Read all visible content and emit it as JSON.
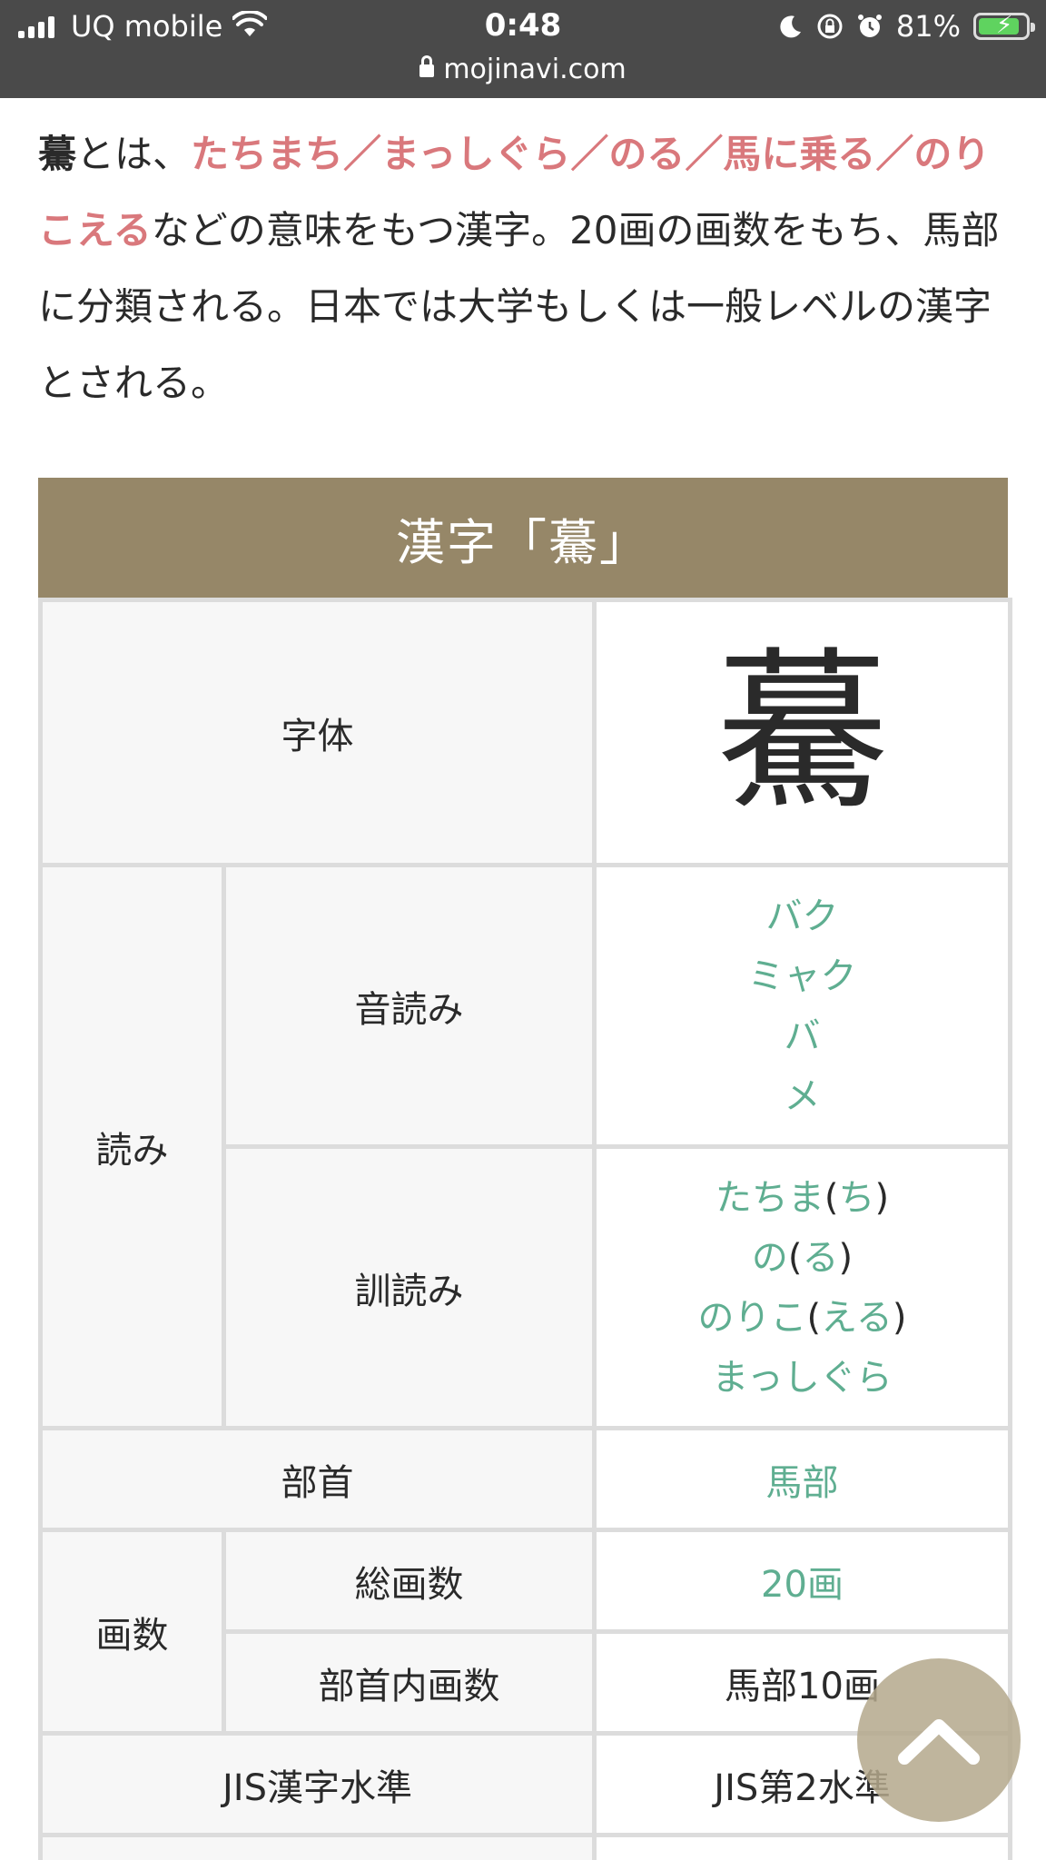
{
  "status_bar": {
    "carrier": "UQ mobile",
    "time": "0:48",
    "battery": "81%",
    "url": "mojinavi.com"
  },
  "intro": {
    "kanji": "驀",
    "after_kanji": "とは、",
    "meanings": "たちまち／まっしぐら／のる／馬に乗る／のりこえる",
    "rest": "などの意味をもつ漢字。20画の画数をもち、馬部に分類される。日本では大学もしくは一般レベルの漢字とされる。"
  },
  "table": {
    "title": "漢字「驀」",
    "jitai_label": "字体",
    "glyph": "驀",
    "yomi_label": "読み",
    "onyomi_label": "音読み",
    "onyomi": [
      "バク",
      "ミャク",
      "バ",
      "メ"
    ],
    "kunyomi_label": "訓読み",
    "kunyomi": [
      {
        "stem": "たちま",
        "okurigana": "ち"
      },
      {
        "stem": "の",
        "okurigana": "る"
      },
      {
        "stem": "のりこ",
        "okurigana": "える"
      },
      {
        "stem": "まっしぐら",
        "okurigana": ""
      }
    ],
    "bushu_label": "部首",
    "bushu": "馬部",
    "kakusu_label": "画数",
    "sou_kakusu_label": "総画数",
    "sou_kakusu": "20画",
    "bushu_nai_label": "部首内画数",
    "bushu_nai": "馬部10画",
    "jis_label": "JIS漢字水準",
    "jis": "JIS第2水準"
  },
  "icons": {
    "scroll_top": "chevron-up-icon"
  }
}
